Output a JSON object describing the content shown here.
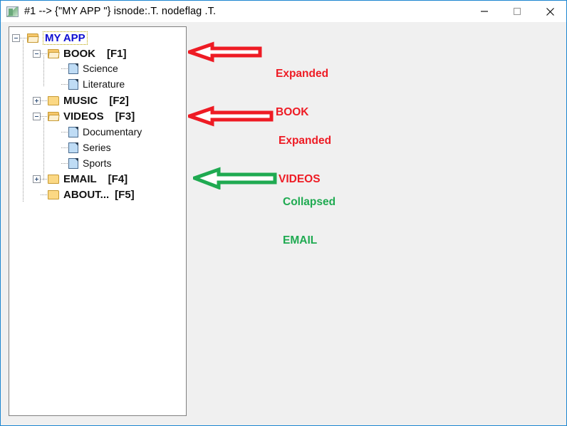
{
  "window": {
    "title": "#1 --> {\"MY APP \"} isnode:.T.  nodeflag .T.",
    "app_icon": "image-thumbnail-icon",
    "background_color": "#f0f0f0",
    "border_color": "#1c86d1",
    "controls": [
      {
        "name": "minimize-button",
        "glyph": "minimize-icon",
        "label": "Minimize"
      },
      {
        "name": "maximize-button",
        "glyph": "maximize-icon",
        "label": "Maximize"
      },
      {
        "name": "close-button",
        "glyph": "close-icon",
        "label": "Close"
      }
    ]
  },
  "tree": {
    "panel_background": "#ffffff",
    "panel_border": "#808080",
    "selected_node": "MY APP",
    "nodes": [
      {
        "label": "MY APP",
        "key": "",
        "depth": 0,
        "state": "expanded",
        "icon": "folder-open-icon",
        "selected": true,
        "bold": true
      },
      {
        "label": "BOOK",
        "key": "[F1]",
        "depth": 1,
        "state": "expanded",
        "icon": "folder-open-icon",
        "selected": false,
        "bold": true
      },
      {
        "label": "Science",
        "key": "",
        "depth": 2,
        "state": "leaf",
        "icon": "document-icon",
        "selected": false,
        "bold": false
      },
      {
        "label": "Literature",
        "key": "",
        "depth": 2,
        "state": "leaf",
        "icon": "document-icon",
        "selected": false,
        "bold": false
      },
      {
        "label": "MUSIC",
        "key": "[F2]",
        "depth": 1,
        "state": "collapsed",
        "icon": "folder-closed-icon",
        "selected": false,
        "bold": true
      },
      {
        "label": "VIDEOS",
        "key": "[F3]",
        "depth": 1,
        "state": "expanded",
        "icon": "folder-open-icon",
        "selected": false,
        "bold": true
      },
      {
        "label": "Documentary",
        "key": "",
        "depth": 2,
        "state": "leaf",
        "icon": "document-icon",
        "selected": false,
        "bold": false
      },
      {
        "label": "Series",
        "key": "",
        "depth": 2,
        "state": "leaf",
        "icon": "document-icon",
        "selected": false,
        "bold": false
      },
      {
        "label": "Sports",
        "key": "",
        "depth": 2,
        "state": "leaf",
        "icon": "document-icon",
        "selected": false,
        "bold": false
      },
      {
        "label": "EMAIL",
        "key": "[F4]",
        "depth": 1,
        "state": "collapsed",
        "icon": "folder-closed-icon",
        "selected": false,
        "bold": true
      },
      {
        "label": "ABOUT...",
        "key": "[F5]",
        "depth": 1,
        "state": "leaf-folder",
        "icon": "folder-closed-icon",
        "selected": false,
        "bold": true
      }
    ]
  },
  "annotations": [
    {
      "name": "annotation-expanded-book",
      "arrow": "left-arrow-outline",
      "color": "#ee1b24",
      "line1": "Expanded",
      "line2": "BOOK"
    },
    {
      "name": "annotation-expanded-videos",
      "arrow": "left-arrow-outline",
      "color": "#ee1b24",
      "line1": "Expanded",
      "line2": "VIDEOS"
    },
    {
      "name": "annotation-collapsed-email",
      "arrow": "left-arrow-outline",
      "color": "#1faa51",
      "line1": "Collapsed",
      "line2": "EMAIL"
    }
  ]
}
